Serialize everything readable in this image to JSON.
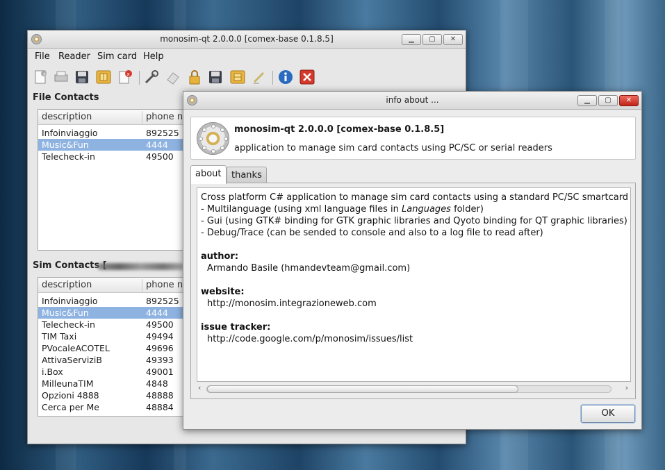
{
  "main_window": {
    "title": "monosim-qt 2.0.0.0 [comex-base 0.1.8.5]",
    "menu": [
      "File",
      "Reader",
      "Sim card",
      "Help"
    ],
    "toolbar_icons": [
      "new-contact-icon",
      "print-icon",
      "save-icon",
      "sim-card-icon",
      "delete-contact-icon",
      "settings-wrench-icon",
      "eraser-icon",
      "lock-icon",
      "save-sim-icon",
      "sim-write-icon",
      "pen-icon",
      "info-icon",
      "close-red-icon"
    ],
    "file_contacts": {
      "label": "File Contacts",
      "columns": [
        "description",
        "phone nu"
      ],
      "rows": [
        {
          "description": "Infoinviaggio",
          "phone": "892525"
        },
        {
          "description": "Music&Fun",
          "phone": "4444",
          "selected": true
        },
        {
          "description": "Telecheck-in",
          "phone": "49500"
        }
      ]
    },
    "sim_contacts": {
      "label": "Sim Contacts [",
      "columns": [
        "description",
        "phone nu"
      ],
      "rows": [
        {
          "description": "Infoinviaggio",
          "phone": "892525"
        },
        {
          "description": "Music&Fun",
          "phone": "4444",
          "selected": true
        },
        {
          "description": "Telecheck-in",
          "phone": "49500"
        },
        {
          "description": "TIM Taxi",
          "phone": "49494"
        },
        {
          "description": "PVocaleACOTEL",
          "phone": "49696"
        },
        {
          "description": "AttivaServiziB",
          "phone": "49393"
        },
        {
          "description": "i.Box",
          "phone": "49001"
        },
        {
          "description": "MilleunaTIM",
          "phone": "4848"
        },
        {
          "description": "Opzioni 4888",
          "phone": "48888"
        },
        {
          "description": "Cerca per Me",
          "phone": "48884"
        }
      ]
    }
  },
  "dialog": {
    "title": "info about ...",
    "header_title": "monosim-qt 2.0.0.0 [comex-base 0.1.8.5]",
    "header_subtitle": "application to manage sim card contacts using PC/SC or serial readers",
    "tabs": [
      "about",
      "thanks"
    ],
    "active_tab": "about",
    "lines": {
      "l1": "Cross platform C# application to manage sim card contacts using a standard PC/SC smartcard reader or",
      "l2a": "- Multilanguage (using xml language files in ",
      "l2b": "Languages",
      "l2c": " folder)",
      "l3": "- Gui (using GTK# binding for GTK graphic libraries and Qyoto binding for QT graphic libraries)",
      "l4": "- Debug/Trace (can be sended to console and also to a log file to read after)",
      "author_label": "author:",
      "author": "Armando Basile (hmandevteam@gmail.com)",
      "website_label": "website:",
      "website": "http://monosim.integrazioneweb.com",
      "issue_label": "issue tracker:",
      "issue": "http://code.google.com/p/monosim/issues/list"
    },
    "ok_label": "OK"
  },
  "colors": {
    "selection": "#8fb3e0",
    "close_red": "#d33a2c",
    "info_blue": "#2a6bc0"
  }
}
